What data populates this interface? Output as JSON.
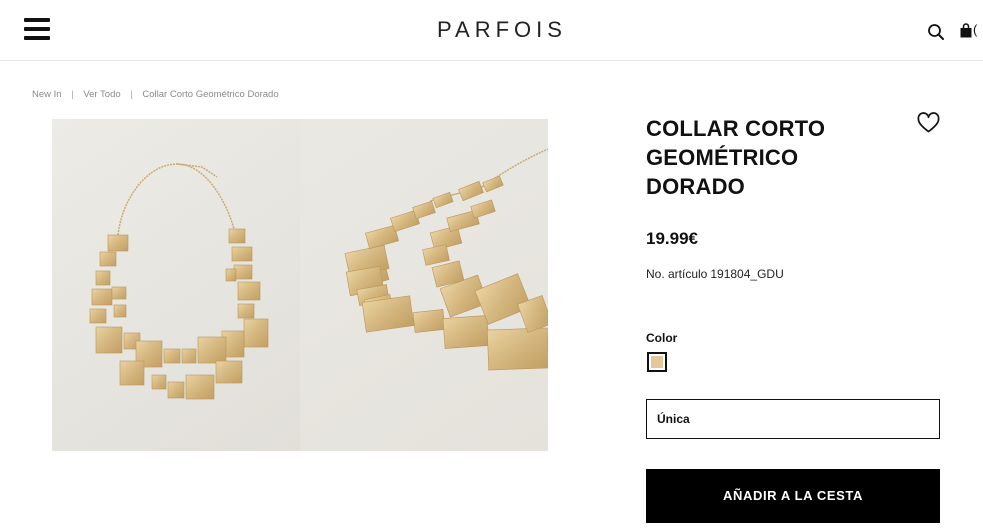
{
  "header": {
    "logo_text": "PARFOIS",
    "bag_count_fragment": "(",
    "icons": {
      "menu": "hamburger-menu-icon",
      "search": "search-icon",
      "bag": "shopping-bag-icon"
    }
  },
  "breadcrumb": {
    "items": [
      "New In",
      "Ver Todo",
      "Collar Corto Geométrico Dorado"
    ],
    "separator": "|"
  },
  "product": {
    "title_lines": [
      "COLLAR CORTO",
      "GEOMÉTRICO",
      "DORADO"
    ],
    "price": "19.99€",
    "sku_label": "No. artículo",
    "sku_value": "191804_GDU",
    "color_label": "Color",
    "color_swatch_hex": "#e3c89b",
    "size_value": "Única",
    "add_to_cart_label": "AÑADIR A LA CESTA",
    "wishlist_icon": "heart-icon"
  },
  "colors": {
    "background": "#ffffff",
    "text": "#111111",
    "muted": "#8a8a8a",
    "button_bg": "#000000",
    "button_text": "#ffffff",
    "gallery_bg": "#e9e7e2",
    "gold": "#d9bf8c"
  }
}
